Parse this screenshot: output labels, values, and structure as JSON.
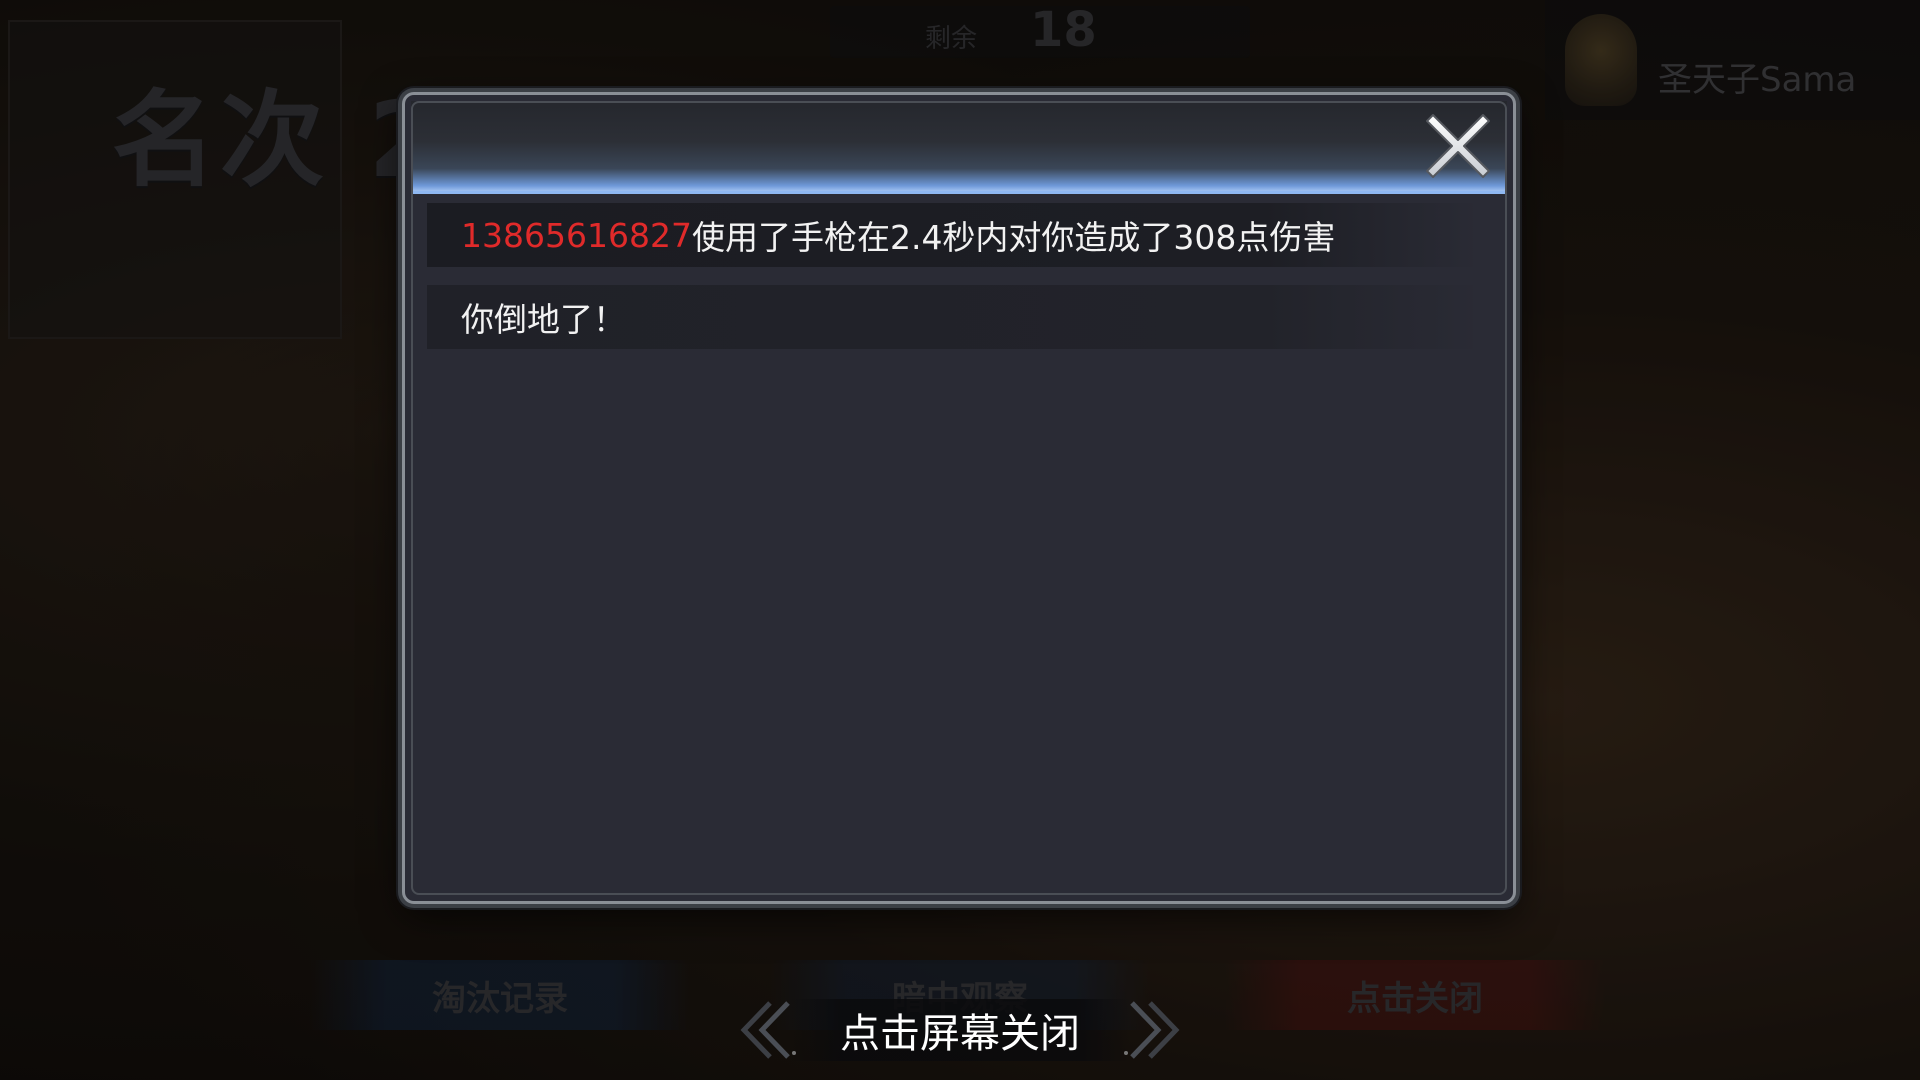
{
  "background": {
    "rank_label": "名次 2",
    "remaining_label": "剩余",
    "remaining_count": "18",
    "player_name": "圣天子Sama",
    "tabs": {
      "elimination_record": "淘汰记录",
      "spectate": "暗中观察",
      "click_close": "点击关闭"
    }
  },
  "dialog": {
    "close_icon": "close-icon",
    "messages": [
      {
        "attacker": "13865616827",
        "text": "使用了手枪在2.4秒内对你造成了308点伤害"
      },
      {
        "attacker": "",
        "text": "你倒地了！"
      }
    ]
  },
  "footer": {
    "tap_close_label": "点击屏幕关闭"
  },
  "colors": {
    "attacker_name": "#e02a2a",
    "dialog_bg": "#2a2b35",
    "header_accent": "#8fb8f2"
  }
}
